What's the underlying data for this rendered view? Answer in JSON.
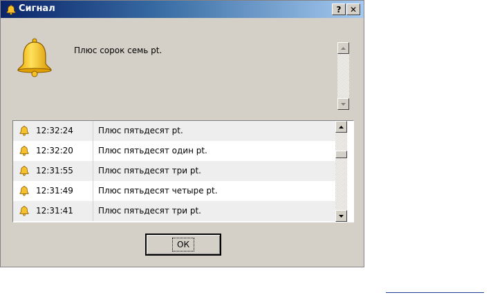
{
  "window": {
    "title": "Сигнал",
    "help_label": "?",
    "close_label": "✕"
  },
  "message": {
    "text": "Плюс сорок семь pt."
  },
  "log": {
    "rows": [
      {
        "time": "12:32:24",
        "text": "Плюс пятьдесят pt."
      },
      {
        "time": "12:32:20",
        "text": "Плюс пятьдесят один pt."
      },
      {
        "time": "12:31:55",
        "text": "Плюс пятьдесят три pt."
      },
      {
        "time": "12:31:49",
        "text": "Плюс пятьдесят четыре pt."
      },
      {
        "time": "12:31:41",
        "text": "Плюс пятьдесят три pt."
      }
    ]
  },
  "buttons": {
    "ok_label": "ОК"
  },
  "colors": {
    "titlebar_start": "#0a246a",
    "titlebar_end": "#a6caf0",
    "dialog_bg": "#d4d0c8",
    "bell": "#f3c623"
  },
  "icons": {
    "title": "bell-icon",
    "message": "bell-icon",
    "row": "bell-icon"
  }
}
